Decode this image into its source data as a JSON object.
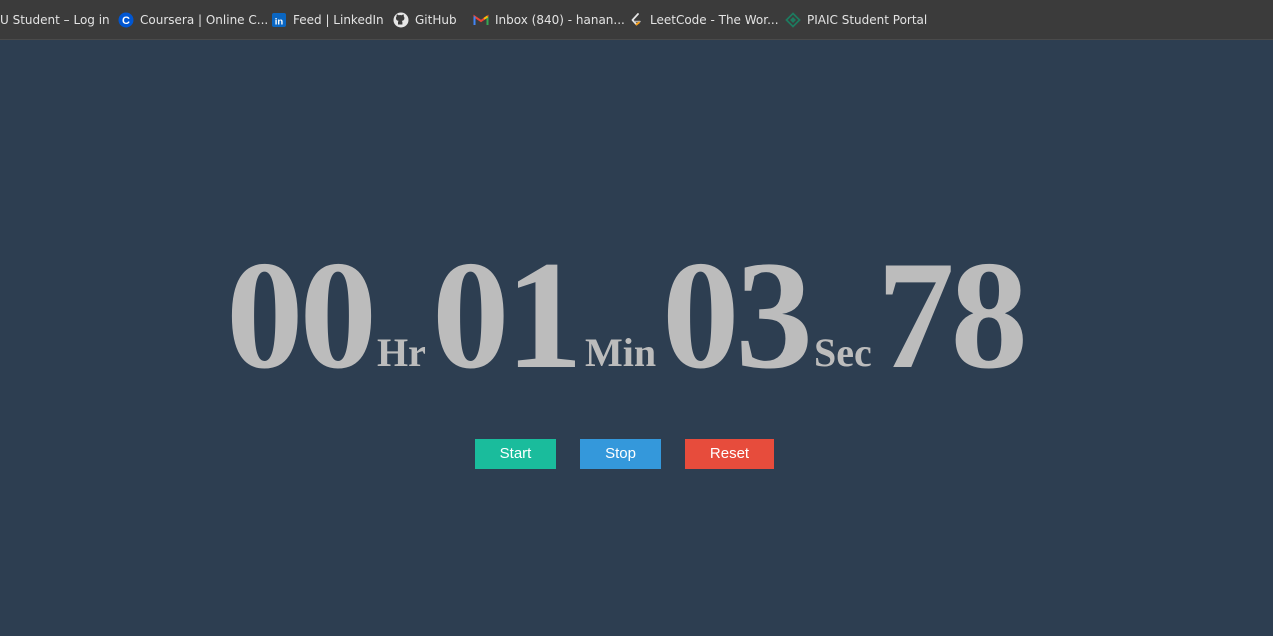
{
  "bookmarks": [
    {
      "label": "U Student – Log in",
      "icon": "none"
    },
    {
      "label": "Coursera | Online C...",
      "icon": "coursera-icon"
    },
    {
      "label": "Feed | LinkedIn",
      "icon": "linkedin-icon"
    },
    {
      "label": "GitHub",
      "icon": "github-icon"
    },
    {
      "label": "Inbox (840) - hanan...",
      "icon": "gmail-icon"
    },
    {
      "label": "LeetCode - The Wor...",
      "icon": "leetcode-icon"
    },
    {
      "label": "PIAIC Student Portal",
      "icon": "piaic-icon"
    }
  ],
  "stopwatch": {
    "hours": "00",
    "hours_unit": "Hr",
    "minutes": "01",
    "minutes_unit": "Min",
    "seconds": "03",
    "seconds_unit": "Sec",
    "centiseconds": "78"
  },
  "buttons": {
    "start": "Start",
    "stop": "Stop",
    "reset": "Reset"
  },
  "colors": {
    "background": "#2d3e51",
    "digits": "#bcbcbc",
    "start": "#1abc9c",
    "stop": "#3498db",
    "reset": "#e74c3c"
  }
}
